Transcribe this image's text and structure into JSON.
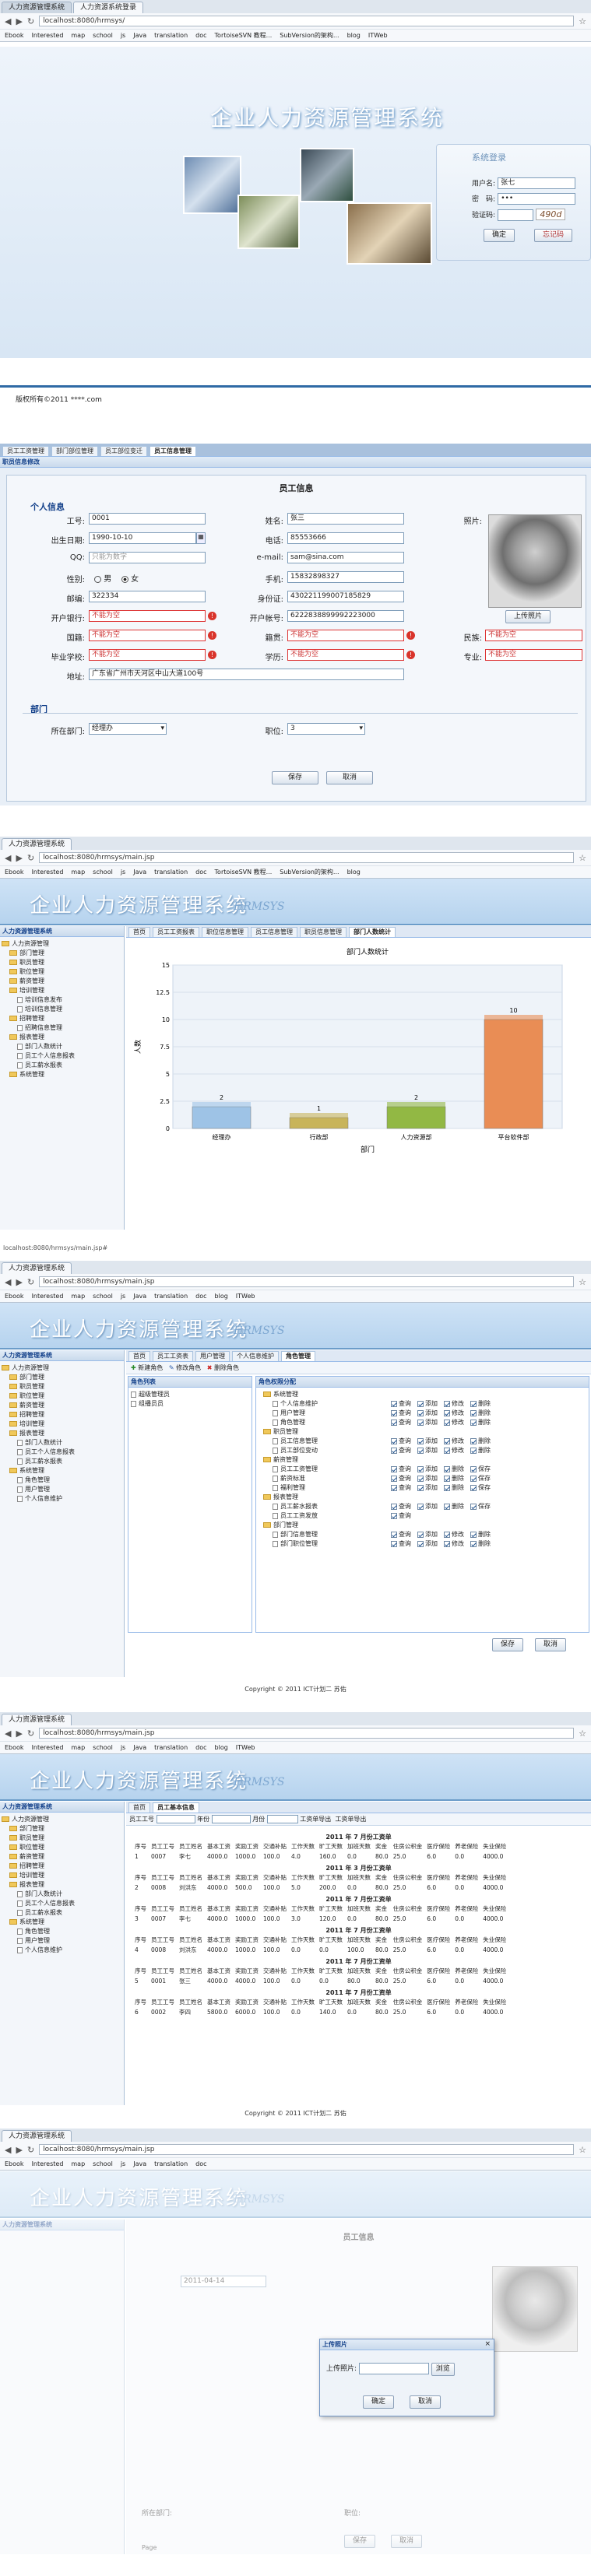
{
  "s1": {
    "tabs": [
      "人力资源管理系统",
      "人力资源系统登录"
    ],
    "url": "localhost:8080/hrmsys/",
    "bookmarks": [
      "Ebook",
      "Interested",
      "map",
      "school",
      "js",
      "Java",
      "translation",
      "doc",
      "TortoiseSVN 教程...",
      "SubVersion的架构...",
      "blog",
      "ITWeb"
    ],
    "title": "企业人力资源管理系统",
    "login_title": "系统登录",
    "user_label": "用户名:",
    "user_value": "张七",
    "pwd_label": "密　码:",
    "pwd_value": "•••",
    "code_label": "验证码:",
    "code_img": "490d",
    "login_btn": "确定",
    "reset_btn": "忘记码",
    "footer": "版权所有©2011 ****.com"
  },
  "s2": {
    "tabs": [
      "员工工资管理",
      "部门部位管理",
      "员工部位变迁",
      "员工信息管理"
    ],
    "panel": "职员信息修改",
    "form_title": "员工信息",
    "section": "个人信息",
    "f": {
      "id_l": "工号:",
      "id": "0001",
      "name_l": "姓名:",
      "name": "张三",
      "photo_l": "照片:",
      "birth_l": "出生日期:",
      "birth": "1990-10-10",
      "phone_l": "电话:",
      "phone": "85553666",
      "qq_l": "QQ:",
      "qq": "只能为数字",
      "email_l": "e-mail:",
      "email": "sam@sina.com",
      "sex_l": "性别:",
      "male": "男",
      "female": "女",
      "mobile_l": "手机:",
      "mobile": "15832898327",
      "post_l": "邮编:",
      "post": "322334",
      "idcard_l": "身份证:",
      "idcard": "430221199007185829",
      "bank_l": "开户银行:",
      "bank": "不能为空",
      "acct_l": "开户帐号:",
      "acct": "6222838899992223000",
      "upload": "上传照片",
      "country_l": "国籍:",
      "country": "不能为空",
      "native_l": "籍贯:",
      "native": "不能为空",
      "nation_l": "民族:",
      "nation": "不能为空",
      "school_l": "毕业学校:",
      "school": "不能为空",
      "edu_l": "学历:",
      "edu": "不能为空",
      "major_l": "专业:",
      "major": "不能为空",
      "addr_l": "地址:",
      "addr": "广东省广州市天河区中山大道100号"
    },
    "dept_section": "部门",
    "dept_l": "所在部门:",
    "dept": "经理办",
    "pos_l": "职位:",
    "pos": "3",
    "save": "保存",
    "cancel": "取消"
  },
  "s3": {
    "tabs": [
      "人力资源管理系统"
    ],
    "url": "localhost:8080/hrmsys/main.jsp",
    "title": "企业人力资源管理系统",
    "tagline": "HRMSYS",
    "menu_title": "人力资源管理系统",
    "tree": [
      "人力资源管理",
      "部门管理",
      "职员管理",
      "职位管理",
      "薪资管理",
      "培训管理",
      "培训信息发布",
      "培训信息管理",
      "招聘管理",
      "招聘信息管理",
      "报表管理",
      "部门人数统计",
      "员工个人信息报表",
      "员工薪水报表",
      "系统管理"
    ],
    "tabbar": [
      "首页",
      "员工工资报表",
      "职位信息管理",
      "员工信息管理",
      "职员信息管理",
      "部门人数统计"
    ],
    "status": "localhost:8080/hrmsys/main.jsp#"
  },
  "chart_data": {
    "type": "bar",
    "title": "部门人数统计",
    "xlabel": "部门",
    "ylabel": "人数",
    "categories": [
      "经理办",
      "行政部",
      "人力资源部",
      "平台软件部"
    ],
    "values": [
      2,
      1,
      2,
      10
    ],
    "ylim": [
      0,
      15
    ],
    "yticks": [
      0,
      2.5,
      5,
      7.5,
      10,
      12.5,
      15
    ],
    "colors": [
      "#9ec3e6",
      "#c8b45a",
      "#92b844",
      "#e98d55"
    ]
  },
  "s4": {
    "url": "localhost:8080/hrmsys/main.jsp",
    "tree": [
      "人力资源管理",
      "部门管理",
      "职员管理",
      "职位管理",
      "薪资管理",
      "招聘管理",
      "培训管理",
      "报表管理",
      "部门人数统计",
      "员工个人信息报表",
      "员工薪水报表",
      "系统管理",
      "角色管理",
      "用户管理",
      "个人信息维护"
    ],
    "tabbar": [
      "首页",
      "员工工资表",
      "用户管理",
      "个人信息维护",
      "角色管理"
    ],
    "toolbar": [
      "新建角色",
      "修改角色",
      "删除角色"
    ],
    "roles_hd": "角色列表",
    "roles": [
      "超级管理员",
      "组播员员"
    ],
    "perm_hd": "角色权限分配",
    "perms": [
      [
        "系统管理",
        ""
      ],
      [
        "个人信息维护",
        "查询 添加 修改 删除"
      ],
      [
        "用户管理",
        "查询 添加 修改 删除"
      ],
      [
        "角色管理",
        "查询 添加 修改 删除"
      ],
      [
        "职员管理",
        ""
      ],
      [
        "员工信息管理",
        "查询 添加 修改 删除"
      ],
      [
        "员工部位变动",
        "查询 添加 修改 删除"
      ],
      [
        "薪资管理",
        ""
      ],
      [
        "员工工资管理",
        "查询 添加 删除 保存"
      ],
      [
        "薪资标准",
        "查询 添加 删除 保存"
      ],
      [
        "福利管理",
        "查询 添加 删除 保存"
      ],
      [
        "报表管理",
        ""
      ],
      [
        "员工薪水报表",
        "查询 添加 删除 保存"
      ],
      [
        "员工工资发放",
        "查询"
      ],
      [
        "部门管理",
        ""
      ],
      [
        "部门信息管理",
        "查询 添加 修改 删除"
      ],
      [
        "部门职位管理",
        "查询 添加 修改 删除"
      ]
    ],
    "save": "保存",
    "cancel": "取消",
    "copyright": "Copyright © 2011 ICT计划二 苏佑"
  },
  "s5": {
    "url": "localhost:8080/hrmsys/main.jsp",
    "tabbar": [
      "首页",
      "员工基本信息"
    ],
    "filter": [
      "员工工号",
      "年份",
      "月份",
      "工资单导出",
      "工资单导出"
    ],
    "header": [
      "序号",
      "员工工号",
      "员工姓名",
      "基本工资",
      "奖励工资",
      "交通补贴",
      "工作天数",
      "旷工天数",
      "加班天数",
      "奖金",
      "住房公积金",
      "医疗保险",
      "养老保险",
      "失业保险",
      "应发工资",
      "实发工资"
    ],
    "slips": [
      {
        "title": "2011 年 7 月份工资单",
        "rows": [
          [
            "1",
            "0007",
            "李七",
            "4000.0",
            "1000.0",
            "100.0",
            "4.0",
            "160.0",
            "0.0",
            "80.0",
            "25.0",
            "6.0",
            "0.0",
            "4000.0"
          ]
        ]
      },
      {
        "title": "2011 年 3 月份工资单",
        "rows": [
          [
            "2",
            "0008",
            "刘洪东",
            "4000.0",
            "500.0",
            "100.0",
            "5.0",
            "200.0",
            "0.0",
            "80.0",
            "25.0",
            "6.0",
            "0.0",
            "4000.0"
          ]
        ]
      },
      {
        "title": "2011 年 7 月份工资单",
        "rows": [
          [
            "3",
            "0007",
            "李七",
            "4000.0",
            "1000.0",
            "100.0",
            "3.0",
            "120.0",
            "0.0",
            "80.0",
            "25.0",
            "6.0",
            "0.0",
            "4000.0"
          ]
        ]
      },
      {
        "title": "2011 年 7 月份工资单",
        "rows": [
          [
            "4",
            "0008",
            "刘洪东",
            "4000.0",
            "1000.0",
            "100.0",
            "0.0",
            "0.0",
            "100.0",
            "80.0",
            "25.0",
            "6.0",
            "0.0",
            "4000.0"
          ]
        ]
      },
      {
        "title": "2011 年 7 月份工资单",
        "rows": [
          [
            "5",
            "0001",
            "张三",
            "4000.0",
            "4000.0",
            "100.0",
            "0.0",
            "0.0",
            "80.0",
            "80.0",
            "25.0",
            "6.0",
            "0.0",
            "4000.0"
          ]
        ]
      },
      {
        "title": "2011 年 7 月份工资单",
        "rows": [
          [
            "6",
            "0002",
            "李四",
            "5800.0",
            "6000.0",
            "100.0",
            "0.0",
            "140.0",
            "0.0",
            "80.0",
            "25.0",
            "6.0",
            "0.0",
            "4000.0"
          ]
        ]
      }
    ],
    "copyright": "Copyright © 2011 ICT计划二 苏佑"
  },
  "s6": {
    "url": "localhost:8080/hrmsys/main.jsp",
    "form_title": "员工信息",
    "dialog_title": "上传照片",
    "dialog_label": "上传照片:",
    "browse": "浏览",
    "ok": "确定",
    "cancel": "取消",
    "date": "2011-04-14",
    "dept_l": "所在部门:",
    "pos_l": "职位:",
    "save": "保存",
    "cancel2": "取消",
    "page": "Page"
  }
}
